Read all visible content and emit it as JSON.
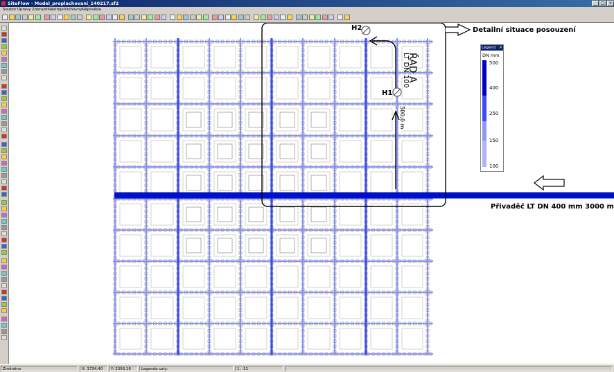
{
  "window": {
    "title": "SiteFlow - Model_proplachovani_140217.sf2",
    "buttons": [
      "_",
      "□",
      "×"
    ]
  },
  "menu": [
    "Soubor",
    "Úpravy",
    "Zobrazit",
    "Nástroje",
    "Knihovny",
    "Nápověda"
  ],
  "annotations": {
    "detail_label": "Detailní situace posouzení",
    "pipe_label": "Přivaděč LT DN 400 mm    3000 m",
    "rad_a": "ŘAD A",
    "lt_dn": "LT DN 100",
    "length": "500,0 m",
    "h1": "H1",
    "h2": "H2"
  },
  "legend": {
    "title": "Legend",
    "close": "×",
    "unit": "DN mm",
    "values": [
      "500",
      "400",
      "250",
      "150",
      "100"
    ],
    "colors": [
      "#0000c8",
      "#3a4ef0",
      "#8f98f0",
      "#aeb4f4"
    ]
  },
  "status": {
    "mode": "Změněno",
    "x": "X: 1734,40",
    "y": "Y: 2393,16",
    "nodes": "Legenda uzly:",
    "coords": "1, -11"
  },
  "colors": {
    "pipe_primary": "#0010c8",
    "pipe_light": "#8b93f2",
    "grid_gray": "#8a8a8a"
  }
}
